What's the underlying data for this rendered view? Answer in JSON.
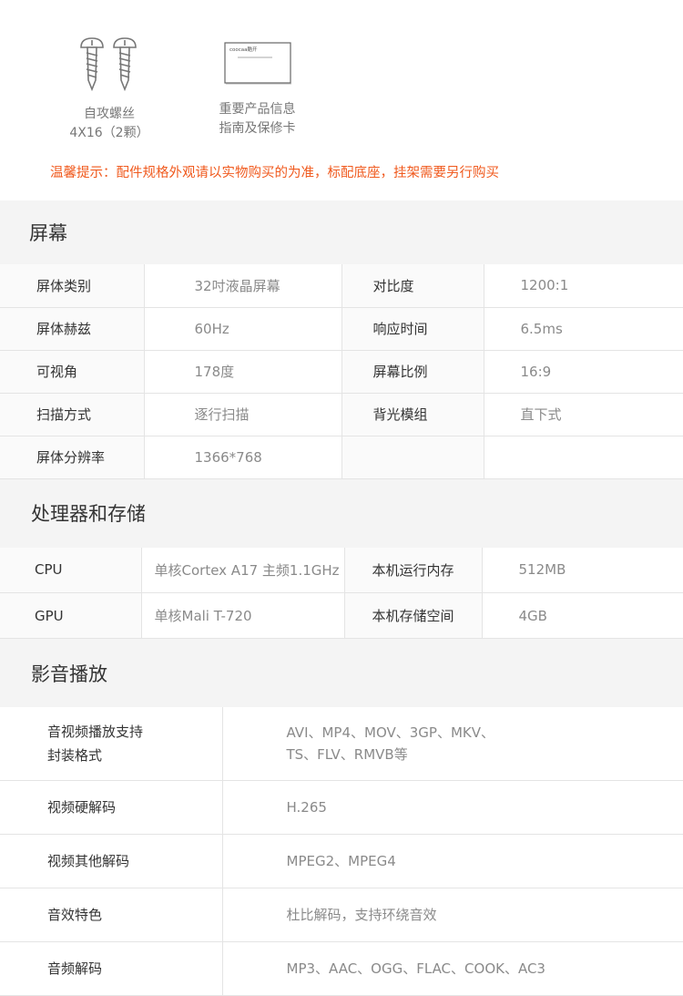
{
  "accessories": {
    "screws": {
      "line1": "自攻螺丝",
      "line2": "4X16（2颗）",
      "icon": "screw-icon"
    },
    "card": {
      "line1": "重要产品信息",
      "line2": "指南及保修卡",
      "icon": "warranty-card-icon",
      "brand": "coocaa酷开"
    },
    "notice": "温馨提示：配件规格外观请以实物购买的为准，标配底座，挂架需要另行购买",
    "notice_color": "#f05a1e"
  },
  "screen": {
    "title": "屏幕",
    "rows": [
      {
        "k1": "屏体类别",
        "v1": "32吋液晶屏幕",
        "k2": "对比度",
        "v2": "1200:1"
      },
      {
        "k1": "屏体赫兹",
        "v1": "60Hz",
        "k2": "响应时间",
        "v2": "6.5ms"
      },
      {
        "k1": "可视角",
        "v1": "178度",
        "k2": "屏幕比例",
        "v2": "16:9"
      },
      {
        "k1": "扫描方式",
        "v1": "逐行扫描",
        "k2": "背光模组",
        "v2": "直下式"
      },
      {
        "k1": "屏体分辨率",
        "v1": "1366*768",
        "k2": "",
        "v2": ""
      }
    ]
  },
  "processor": {
    "title": "处理器和存储",
    "rows": [
      {
        "k1": "CPU",
        "v1": "单核Cortex A17 主频1.1GHz",
        "k2": "本机运行内存",
        "v2": "512MB"
      },
      {
        "k1": "GPU",
        "v1": "单核Mali T-720",
        "k2": "本机存储空间",
        "v2": "4GB"
      }
    ]
  },
  "media": {
    "title": "影音播放",
    "rows": [
      {
        "k": "音视频播放支持\n封装格式",
        "v": "AVI、MP4、MOV、3GP、MKV、\nTS、FLV、RMVB等"
      },
      {
        "k": "视频硬解码",
        "v": "H.265"
      },
      {
        "k": "视频其他解码",
        "v": "MPEG2、MPEG4"
      },
      {
        "k": "音效特色",
        "v": "杜比解码，支持环绕音效"
      },
      {
        "k": "音频解码",
        "v": "MP3、AAC、OGG、FLAC、COOK、AC3"
      }
    ]
  }
}
